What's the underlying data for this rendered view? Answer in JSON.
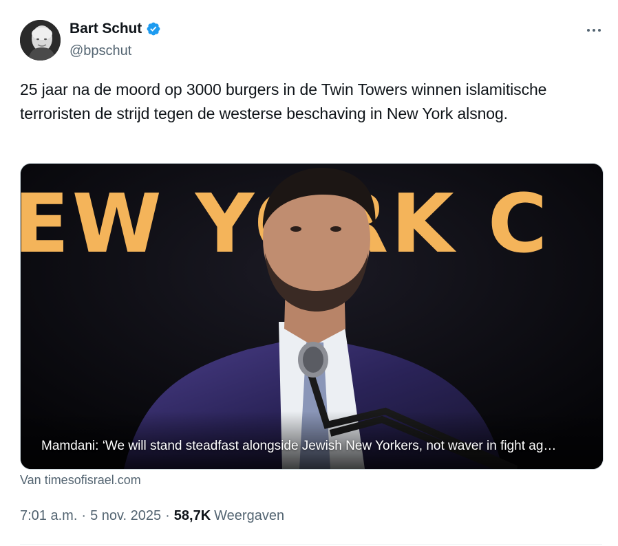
{
  "author": {
    "display_name": "Bart Schut",
    "handle": "@bpschut",
    "verified": true,
    "avatar_icon": "user-avatar"
  },
  "tweet": {
    "text": "25 jaar na de moord op 3000 burgers in de Twin Towers winnen islamitische terroristen de strijd tegen de westerse beschaving in New York alsnog."
  },
  "card": {
    "image_banner_text": "EW YORK C",
    "caption": "Mamdani: ‘We will stand steadfast alongside Jewish New Yorkers, not waver in fight ag…",
    "source": "Van timesofisrael.com"
  },
  "meta": {
    "time": "7:01 a.m.",
    "date": "5 nov. 2025",
    "separator": "·",
    "views_count": "58,7K",
    "views_label": "Weergaven"
  },
  "colors": {
    "text_primary": "#0f1419",
    "text_secondary": "#536471",
    "verified_blue": "#1d9bf0",
    "border": "#cfd9de"
  },
  "icons": {
    "more": "more-horizontal-icon",
    "verified": "verified-badge-icon"
  }
}
